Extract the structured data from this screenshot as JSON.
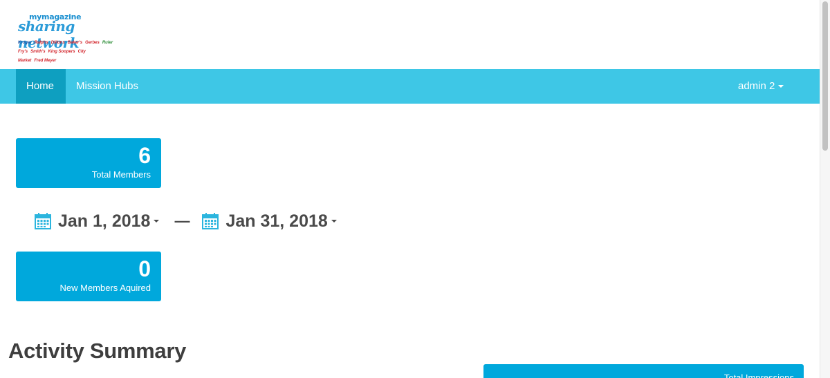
{
  "logo": {
    "top_text": "mymagazine",
    "script_text": "sharing network",
    "brands": [
      "Kroger",
      "Ralphs",
      "Dillons",
      "Baker's",
      "Gerbes",
      "Ruler",
      "Fry's",
      "Smith's",
      "King Soopers",
      "City Market",
      "Fred Meyer"
    ]
  },
  "nav": {
    "home": "Home",
    "mission_hubs": "Mission Hubs",
    "user": "admin 2"
  },
  "stats": {
    "total_members": {
      "value": "6",
      "label": "Total Members"
    },
    "new_members": {
      "value": "0",
      "label": "New Members Aquired"
    }
  },
  "daterange": {
    "start": "Jan 1, 2018",
    "separator": "—",
    "end": "Jan 31, 2018"
  },
  "activity": {
    "title": "Activity Summary",
    "impressions_label": "Total Impressions"
  },
  "colors": {
    "navbar": "#3ec7e6",
    "nav_active": "#0e9fc0",
    "card": "#00a8dc",
    "calendar_icon": "#2bb5de"
  }
}
